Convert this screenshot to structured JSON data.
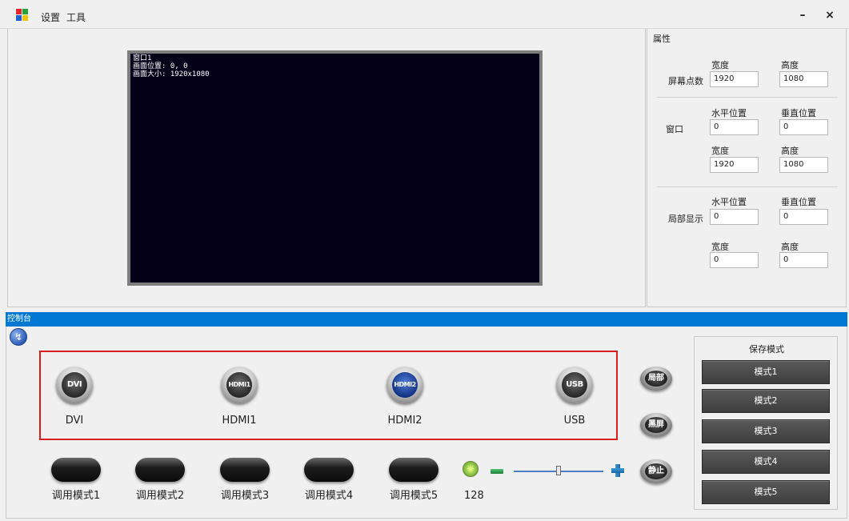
{
  "menu": {
    "settings": "设置",
    "tools": "工具"
  },
  "window": {
    "minimize": "–",
    "close": "×"
  },
  "preview": {
    "lines": [
      "窗口1",
      "画面位置: 0, 0",
      "画面大小: 1920x1080"
    ]
  },
  "properties": {
    "title": "属性",
    "width_label": "宽度",
    "height_label": "高度",
    "hpos_label": "水平位置",
    "vpos_label": "垂直位置",
    "screen_points": {
      "label": "屏幕点数",
      "width": "1920",
      "height": "1080"
    },
    "window": {
      "label": "窗口",
      "hpos": "0",
      "vpos": "0",
      "width": "1920",
      "height": "1080"
    },
    "partial_display": {
      "label": "局部显示",
      "hpos": "0",
      "vpos": "0",
      "width": "0",
      "height": "0"
    }
  },
  "console": {
    "title": "控制台",
    "sources": [
      {
        "icon_text": "DVI",
        "label": "DVI"
      },
      {
        "icon_text": "HDMI1",
        "label": "HDMI1"
      },
      {
        "icon_text": "HDMI2",
        "label": "HDMI2"
      },
      {
        "icon_text": "USB",
        "label": "USB"
      }
    ],
    "round_buttons": {
      "partial": "局部",
      "black_screen": "黑屏",
      "freeze": "静止"
    },
    "call_modes": [
      "调用模式1",
      "调用模式2",
      "调用模式3",
      "调用模式4",
      "调用模式5"
    ],
    "brightness": {
      "value": "128",
      "fraction": 0.5
    }
  },
  "save_modes": {
    "title": "保存模式",
    "modes": [
      "模式1",
      "模式2",
      "模式3",
      "模式4",
      "模式5"
    ]
  },
  "colors": {
    "accent": "#0078d4",
    "highlight_border": "#d81e1e",
    "screen_bg": "#030018",
    "logo": [
      "#e8262a",
      "#24a339",
      "#1f5fd1",
      "#f5c400"
    ]
  }
}
